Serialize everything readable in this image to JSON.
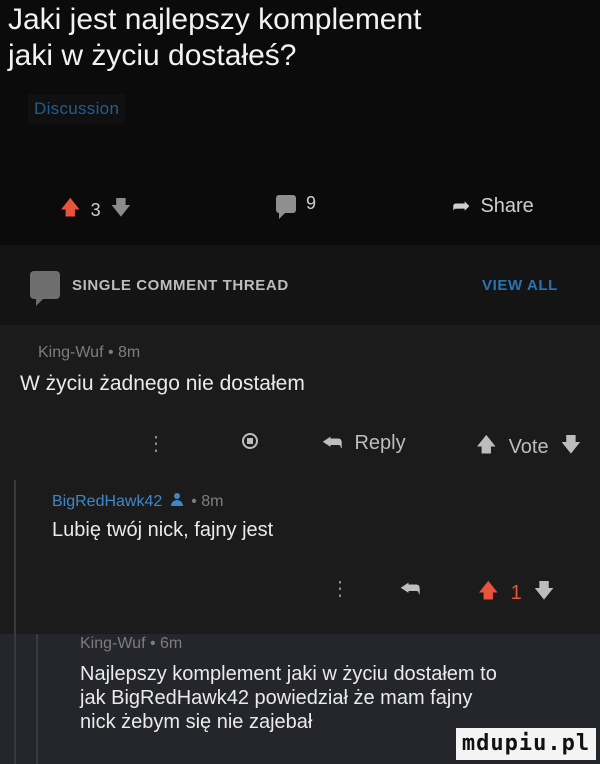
{
  "post": {
    "title_line1": "Jaki jest najlepszy komplement",
    "title_line2": "jaki w życiu dostałeś?",
    "flair": "Discussion",
    "upvotes": "3",
    "comments": "9",
    "share_label": "Share"
  },
  "thread": {
    "label": "SINGLE COMMENT THREAD",
    "view_all": "VIEW ALL"
  },
  "comments": [
    {
      "author": "King-Wuf",
      "age": "8m",
      "text": "W życiu żadnego nie dostałem",
      "reply_label": "Reply",
      "vote_label": "Vote"
    },
    {
      "author": "BigRedHawk42",
      "age": "8m",
      "text": "Lubię twój nick, fajny jest",
      "score": "1"
    },
    {
      "author": "King-Wuf",
      "age": "6m",
      "text_line1": "Najlepszy komplement jaki w życiu dostałem to",
      "text_line2": "jak BigRedHawk42 powiedział że mam fajny",
      "text_line3": "nick żebym się nie zajebał"
    }
  ],
  "watermark": "mdupiu.pl",
  "icons": [
    "upvote-arrow-icon",
    "downvote-arrow-icon",
    "comment-bubble-icon",
    "share-arrow-icon",
    "reply-arrow-icon",
    "award-icon",
    "more-dots-icon",
    "op-person-icon"
  ],
  "colors": {
    "upvote": "#e8533c",
    "link_blue": "#2a73b3",
    "author_blue": "#3f87c9"
  }
}
